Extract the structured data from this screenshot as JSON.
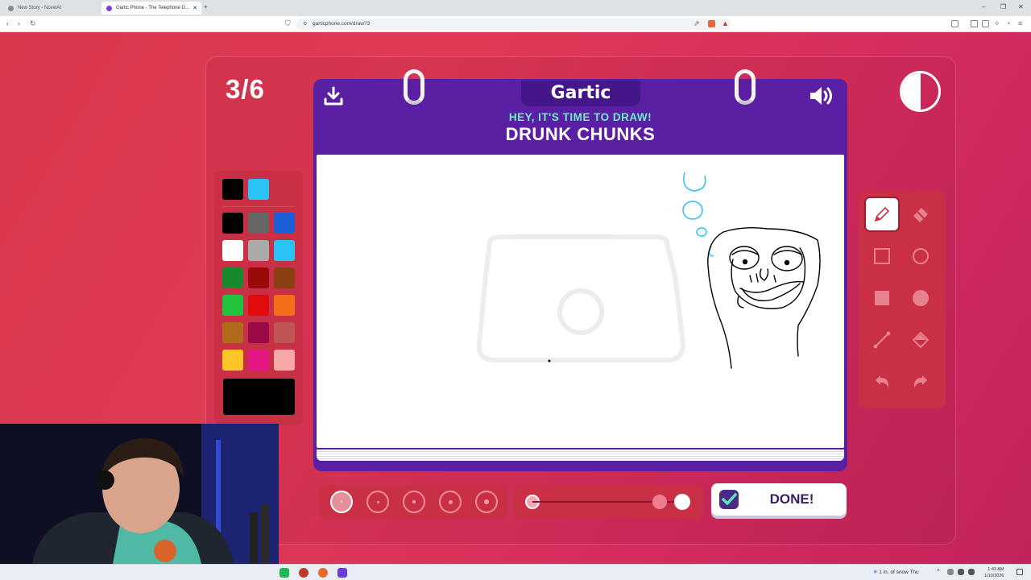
{
  "browser": {
    "tabs": [
      {
        "title": "New Story - NovelAI",
        "active": false
      },
      {
        "title": "Gartic Phone - The Telephone G...",
        "active": true
      }
    ],
    "url": "garticphone.com/draw?3"
  },
  "game": {
    "round": "3/6",
    "logo": "Gartic",
    "prompt_header": "HEY, IT'S TIME TO DRAW!",
    "prompt_word": "DRUNK CHUNKS",
    "done_label": "DONE!",
    "selected_tool": "pencil",
    "selected_brush_size_index": 0,
    "opacity_level": 0.9,
    "current_color": "#000000"
  },
  "palette": {
    "recent": [
      "#000000",
      "#29c3f5"
    ],
    "colors": [
      "#000000",
      "#666666",
      "#1d5fd6",
      "#ffffff",
      "#aaaaaa",
      "#29c3f5",
      "#168a2a",
      "#9b0a0a",
      "#8b4014",
      "#22c33c",
      "#e10c0c",
      "#f56d18",
      "#b26a1d",
      "#9b0a48",
      "#c05555",
      "#fdc527",
      "#e61785",
      "#f7a8a8"
    ]
  },
  "taskbar": {
    "weather": "1 in. of snow Thu",
    "time": "1:43 AM",
    "date": "1/10/2026"
  }
}
